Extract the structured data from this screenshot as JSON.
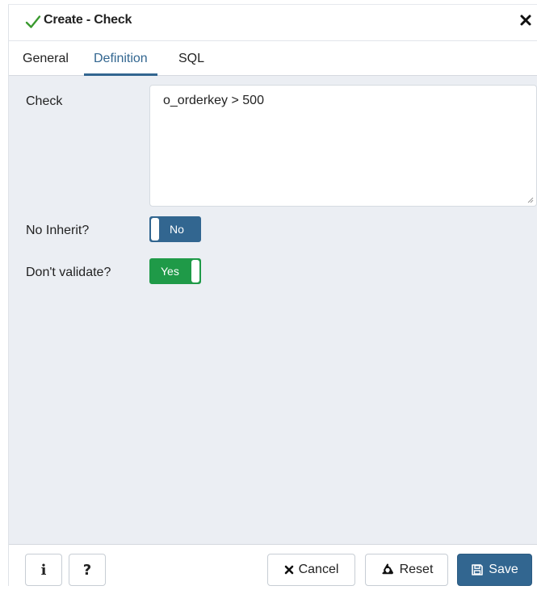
{
  "dialog": {
    "title": "Create - Check",
    "close_icon": "close-icon"
  },
  "tabs": [
    {
      "label": "General",
      "active": false
    },
    {
      "label": "Definition",
      "active": true
    },
    {
      "label": "SQL",
      "active": false
    }
  ],
  "form": {
    "check": {
      "label": "Check",
      "value": "o_orderkey > 500"
    },
    "no_inherit": {
      "label": "No Inherit?",
      "value": "No"
    },
    "dont_validate": {
      "label": "Don't validate?",
      "value": "Yes"
    }
  },
  "footer": {
    "info_label": "i",
    "help_label": "?",
    "cancel_label": "Cancel",
    "reset_label": "Reset",
    "save_label": "Save"
  },
  "colors": {
    "accent": "#326690",
    "success": "#1f9a48",
    "body_bg": "#ebeef3",
    "title_check": "#3a9a2f"
  }
}
